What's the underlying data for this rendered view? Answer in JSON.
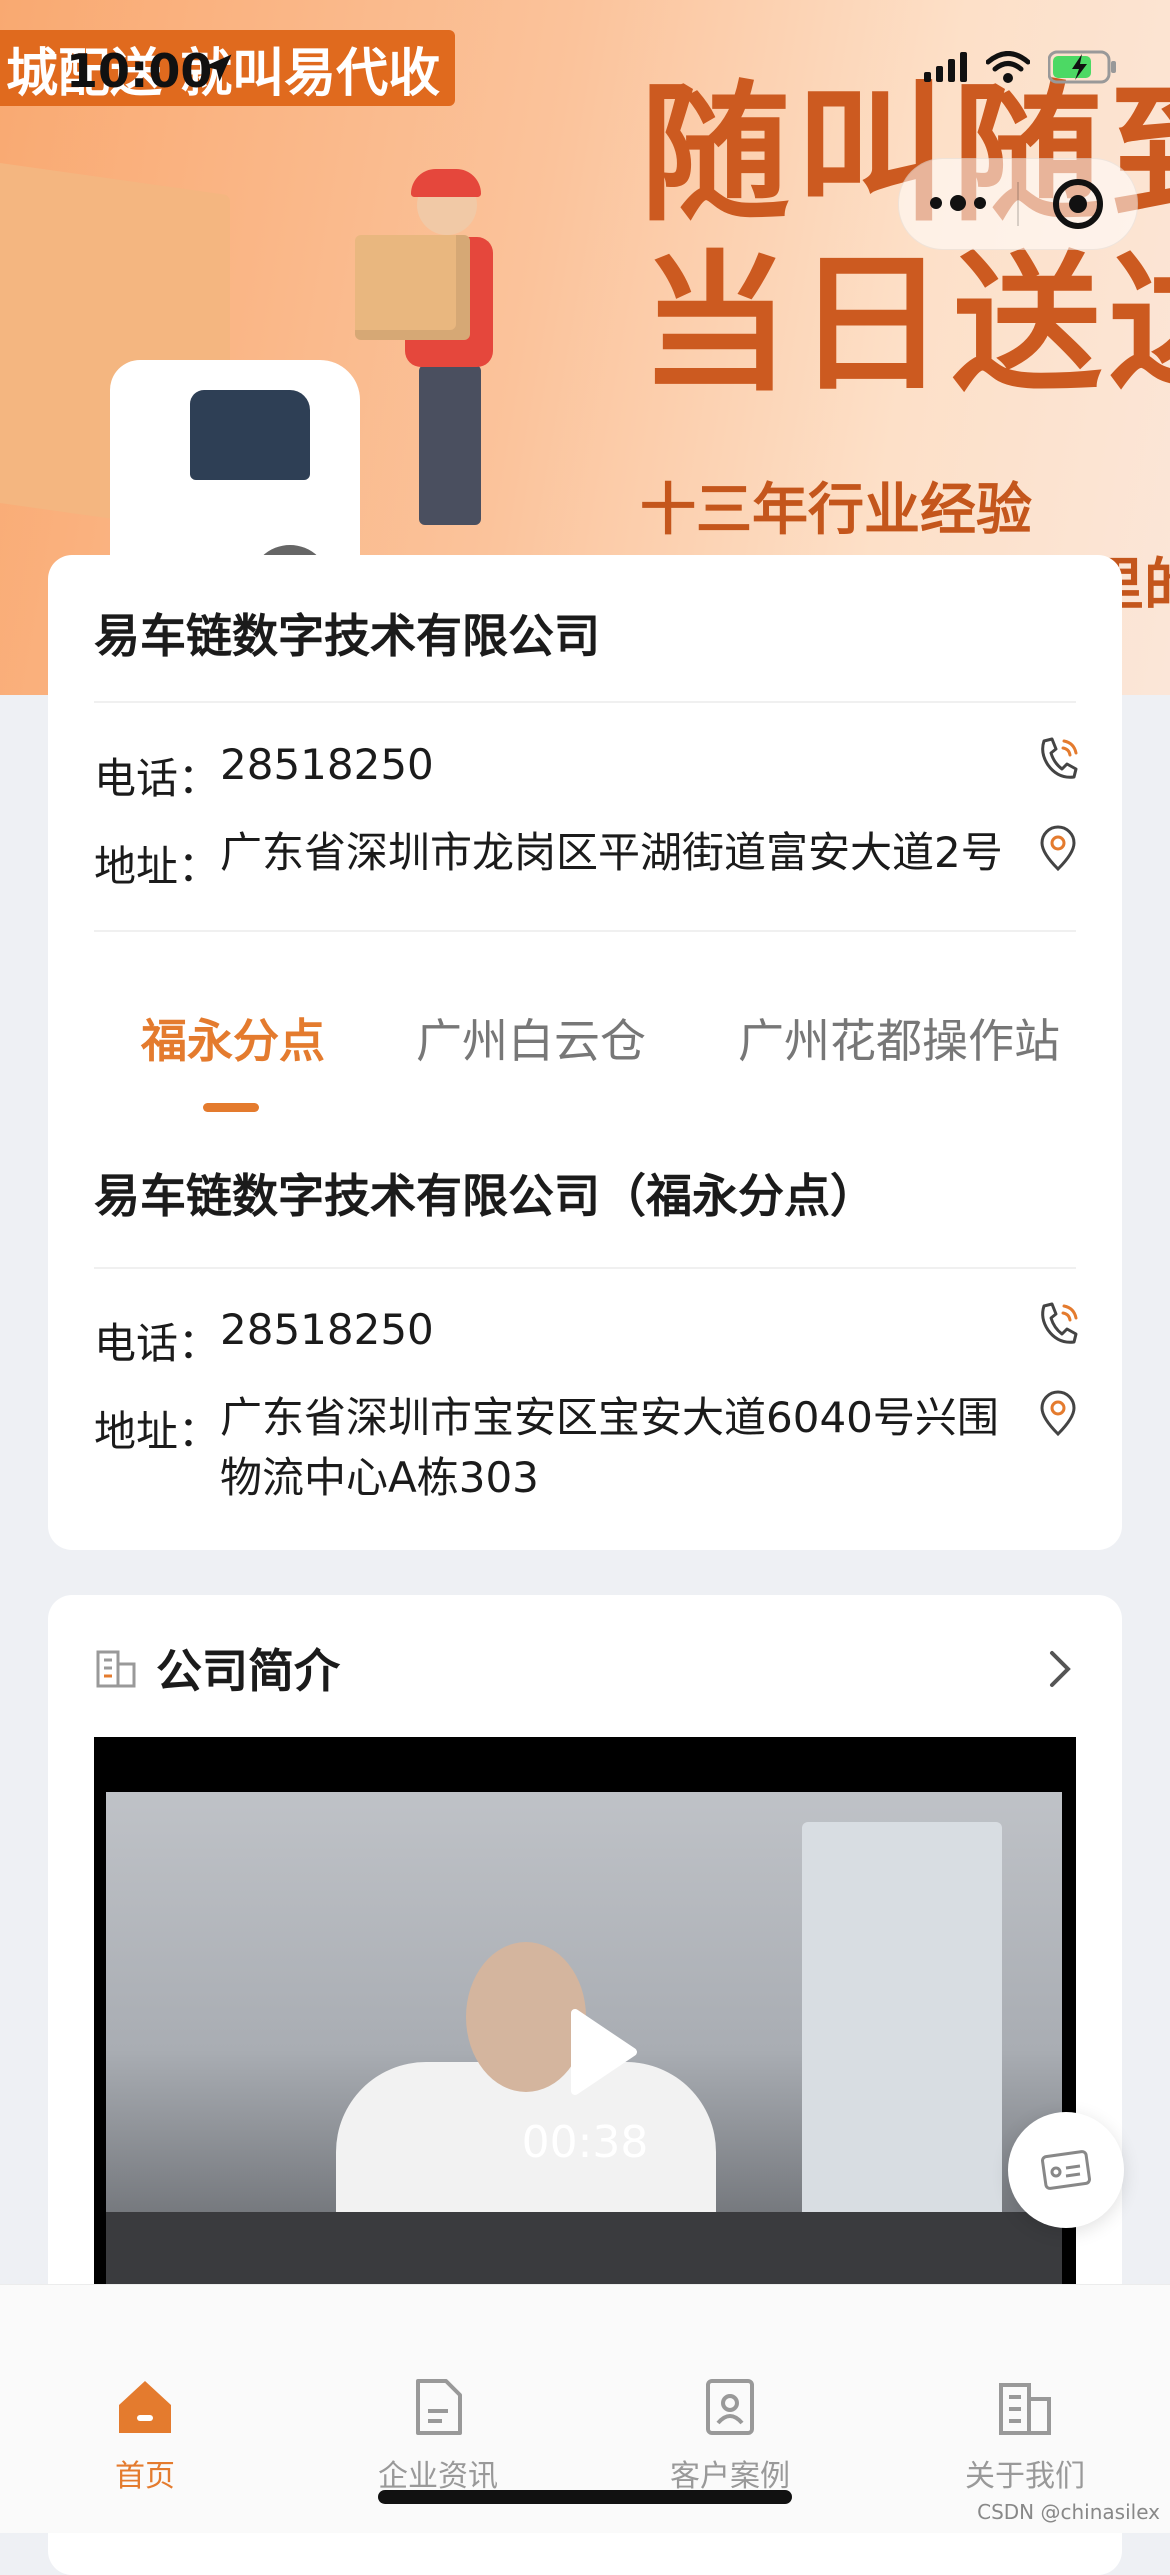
{
  "status_bar": {
    "time": "10:00"
  },
  "banner": {
    "promo_tag": "城配送 就叫易代收",
    "slogan_line1": "随叫随到",
    "slogan_line2": "当日送达",
    "slogan_sub": "十三年行业经验",
    "slogan_sub2": "解决商户最后一公里的"
  },
  "company": {
    "name": "易车链数字技术有限公司",
    "phone_label": "电话：",
    "phone": "28518250",
    "address_label": "地址：",
    "address": "广东省深圳市龙岗区平湖街道富安大道2号"
  },
  "branch_tabs": [
    {
      "label": "福永分点",
      "active": true
    },
    {
      "label": "广州白云仓",
      "active": false
    },
    {
      "label": "广州花都操作站",
      "active": false
    }
  ],
  "branch": {
    "name": "易车链数字技术有限公司（福永分点）",
    "phone_label": "电话：",
    "phone": "28518250",
    "address_label": "地址：",
    "address_line1": "广东省深圳市宝安区宝安大道6040号兴围",
    "address_line2": "物流中心A栋303"
  },
  "intro": {
    "title": "公司简介",
    "video_duration": "00:38"
  },
  "tabbar": [
    {
      "label": "首页",
      "icon": "home-icon",
      "active": true
    },
    {
      "label": "企业资讯",
      "icon": "document-icon",
      "active": false
    },
    {
      "label": "客户案例",
      "icon": "contact-card-icon",
      "active": false
    },
    {
      "label": "关于我们",
      "icon": "building-icon",
      "active": false
    }
  ],
  "watermark": "CSDN @chinasilex",
  "colors": {
    "accent": "#e47b2e",
    "banner_orange": "#cc5a20"
  }
}
